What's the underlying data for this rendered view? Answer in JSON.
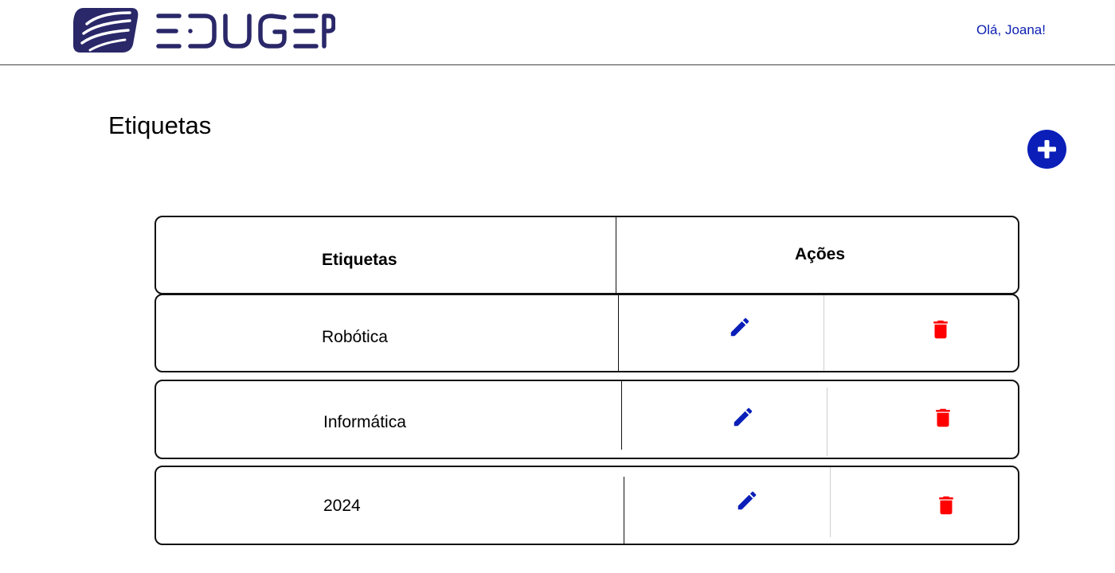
{
  "header": {
    "brand": "EDUGEP",
    "greeting": "Olá, Joana!"
  },
  "page": {
    "title": "Etiquetas",
    "add_icon": "plus-circle-icon"
  },
  "table": {
    "columns": [
      "Etiquetas",
      "Ações"
    ],
    "rows": [
      {
        "label": "Robótica",
        "edit_icon": "pencil-icon",
        "delete_icon": "trash-icon"
      },
      {
        "label": "Informática",
        "edit_icon": "pencil-icon",
        "delete_icon": "trash-icon"
      },
      {
        "label": "2024",
        "edit_icon": "pencil-icon",
        "delete_icon": "trash-icon"
      }
    ]
  },
  "colors": {
    "brand": "#2a2869",
    "accent": "#0b1fb8",
    "greeting": "#0b1fb0",
    "danger": "#ff0000"
  }
}
